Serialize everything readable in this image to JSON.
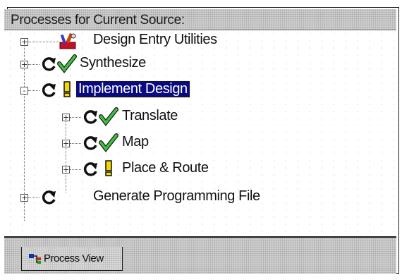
{
  "panel": {
    "title": "Processes for Current Source:"
  },
  "tree": {
    "items": [
      {
        "label": "Design Entry Utilities",
        "icon": "tools-icon",
        "status": "none",
        "expander": "+"
      },
      {
        "label": "Synthesize",
        "icon": "process-icon",
        "status": "check",
        "expander": "+"
      },
      {
        "label": "Implement Design",
        "icon": "process-icon",
        "status": "warning",
        "expander": "-",
        "selected": true
      },
      {
        "label": "Translate",
        "icon": "process-icon",
        "status": "check",
        "expander": "+"
      },
      {
        "label": "Map",
        "icon": "process-icon",
        "status": "check",
        "expander": "+"
      },
      {
        "label": "Place & Route",
        "icon": "process-icon",
        "status": "warning",
        "expander": "+"
      },
      {
        "label": "Generate Programming File",
        "icon": "process-icon",
        "status": "none",
        "expander": "+"
      }
    ]
  },
  "tabs": [
    {
      "label": "Process View",
      "icon": "process-view-icon"
    }
  ],
  "colors": {
    "selection": "#0a0a80",
    "check": "#2ea82e",
    "warning": "#e8d000"
  }
}
